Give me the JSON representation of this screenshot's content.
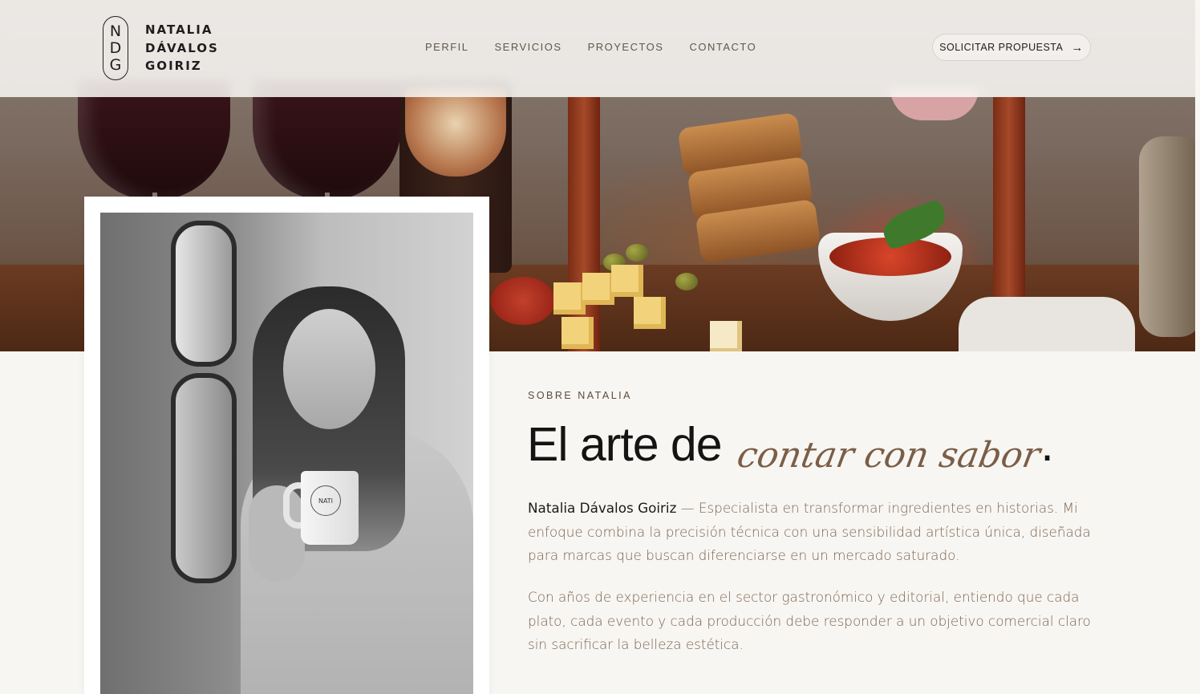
{
  "header": {
    "logo_letters": [
      "N",
      "D",
      "G"
    ],
    "logo_lines": [
      "NATALIA",
      "DÁVALOS",
      "GOIRIZ"
    ],
    "nav": [
      "PERFIL",
      "SERVICIOS",
      "PROYECTOS",
      "CONTACTO"
    ],
    "cta_label": "SOLICITAR PROPUESTA",
    "cta_icon": "arrow-right-icon"
  },
  "about": {
    "eyebrow": "SOBRE NATALIA",
    "title_plain": "El arte de",
    "title_script": "contar con sabor",
    "title_dot": ".",
    "intro_name": "Natalia Dávalos Goiriz",
    "intro_text": " — Especialista en transformar ingredientes en historias. Mi enfoque combina la precisión técnica con una sensibilidad artística única, diseñada para marcas que buscan diferenciarse en un mercado saturado.",
    "paragraph2": "Con años de experiencia en el sector gastronómico y editorial, entiendo que cada plato, cada evento y cada producción debe responder a un objetivo comercial claro sin sacrificar la belleza estética."
  },
  "portrait": {
    "mug_text": "NATI"
  },
  "colors": {
    "background": "#f8f6f2",
    "accent_brown": "#7a5e48",
    "body_text": "#7a6454"
  }
}
